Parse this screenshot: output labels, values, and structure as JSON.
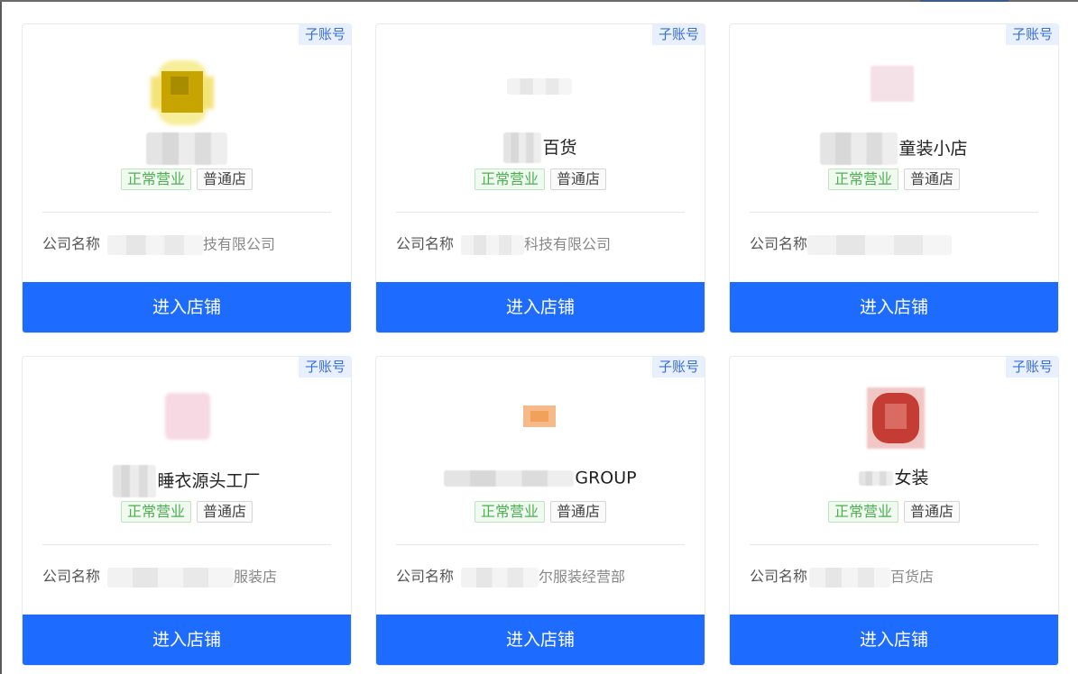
{
  "shops": [
    {
      "name_suffix": "",
      "company_prefix": "公司名称",
      "company_suffix": "技有限公司",
      "badge_status": "正常营业",
      "badge_type": "普通店",
      "sub_tag": "子账号",
      "button": "进入店铺",
      "logo_colors": [
        "#c9a800",
        "#f2e27a"
      ]
    },
    {
      "name_suffix": "百货",
      "company_prefix": "公司名称",
      "company_suffix": "科技有限公司",
      "badge_status": "正常营业",
      "badge_type": "普通店",
      "sub_tag": "子账号",
      "button": "进入店铺",
      "logo_colors": [
        "#d6d6d6",
        "#ececec"
      ]
    },
    {
      "name_suffix": "童装小店",
      "company_prefix": "公司名称",
      "company_suffix": "",
      "badge_status": "正常营业",
      "badge_type": "普通店",
      "sub_tag": "子账号",
      "button": "进入店铺",
      "logo_colors": [
        "#f1dbe2",
        "#f8ecef"
      ]
    },
    {
      "name_suffix": "睡衣源头工厂",
      "company_prefix": "公司名称",
      "company_suffix": "服装店",
      "badge_status": "正常营业",
      "badge_type": "普通店",
      "sub_tag": "子账号",
      "button": "进入店铺",
      "logo_colors": [
        "#f4d3dd",
        "#fbe9ee"
      ]
    },
    {
      "name_suffix": "GROUP",
      "company_prefix": "公司名称",
      "company_suffix": "尔服装经营部",
      "badge_status": "正常营业",
      "badge_type": "普通店",
      "sub_tag": "子账号",
      "button": "进入店铺",
      "logo_colors": [
        "#f2a15a",
        "#f8caa0"
      ]
    },
    {
      "name_suffix": "女装",
      "company_prefix": "公司名称",
      "company_suffix": "百货店",
      "badge_status": "正常营业",
      "badge_type": "普通店",
      "sub_tag": "子账号",
      "button": "进入店铺",
      "logo_colors": [
        "#c0342c",
        "#e5a3a0"
      ]
    }
  ]
}
